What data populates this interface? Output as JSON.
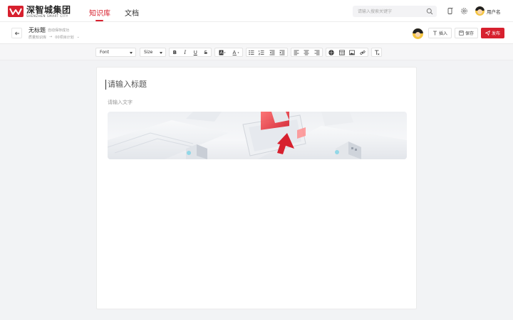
{
  "app": {
    "logo_cn": "深智城集团",
    "logo_en": "SHENZHEN SMART CITY",
    "brand_color": "#d7202e"
  },
  "nav": {
    "tabs": [
      {
        "label": "知识库",
        "active": true
      },
      {
        "label": "文档",
        "active": false
      }
    ]
  },
  "search": {
    "placeholder": "请输入搜索关键字"
  },
  "user": {
    "name": "用户名"
  },
  "doc": {
    "title": "无标题",
    "save_status": "自动保存成功",
    "breadcrumb": [
      "质量知识库",
      "→",
      "00项目计划",
      "⌄"
    ]
  },
  "actions": {
    "insert": "插入",
    "save": "保存",
    "publish": "发布"
  },
  "toolbar": {
    "font_label": "Font",
    "size_label": "Size"
  },
  "editor": {
    "title_placeholder": "请输入标题",
    "body_placeholder": "请输入文字"
  }
}
